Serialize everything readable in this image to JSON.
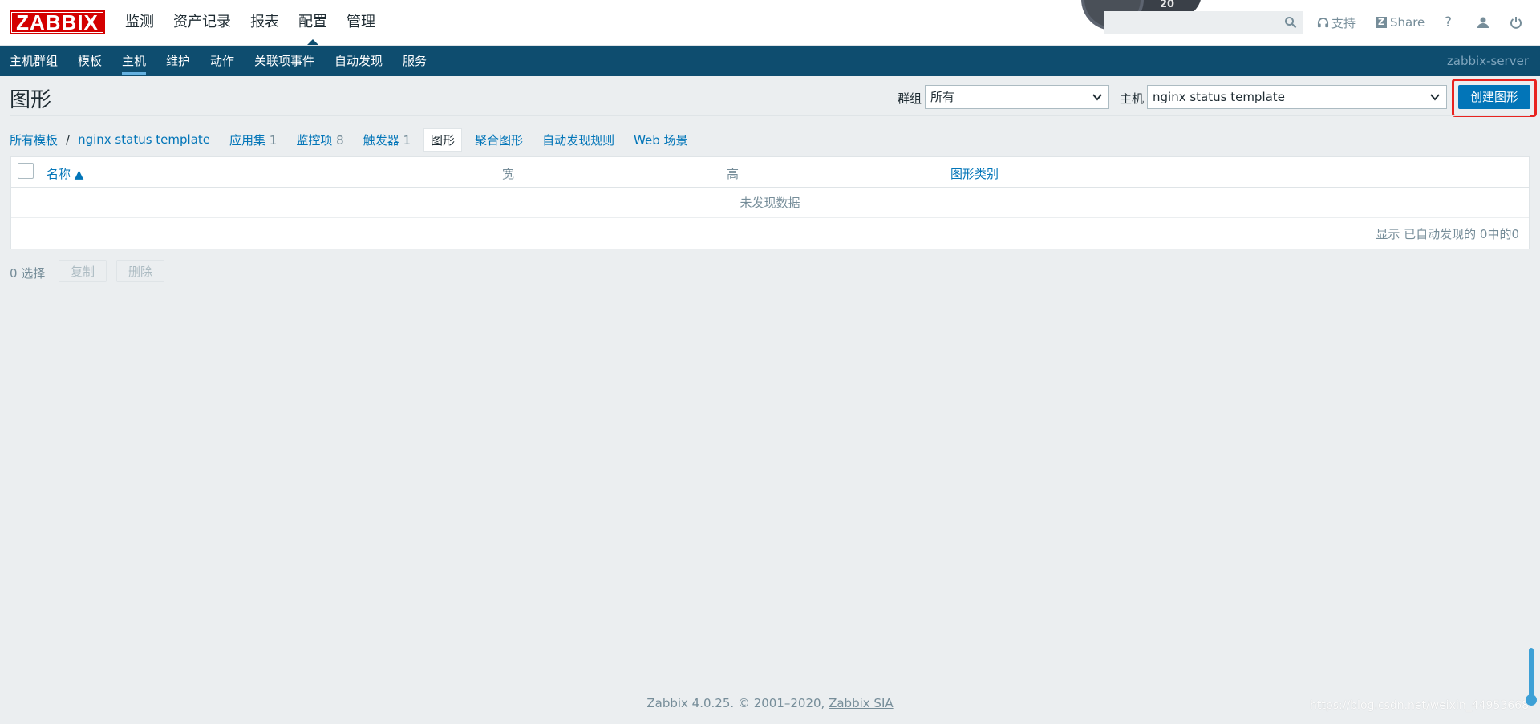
{
  "app": {
    "logo": "ZABBIX",
    "server_name": "zabbix-server"
  },
  "main_nav": [
    "监测",
    "资产记录",
    "报表",
    "配置",
    "管理"
  ],
  "main_nav_active": "配置",
  "top_right": {
    "support": "支持",
    "share": "Share",
    "help": "?",
    "gauge_value": "20"
  },
  "sub_nav": [
    "主机群组",
    "模板",
    "主机",
    "维护",
    "动作",
    "关联项事件",
    "自动发现",
    "服务"
  ],
  "sub_nav_active": "主机",
  "page": {
    "title": "图形",
    "filter_group_label": "群组",
    "filter_group_value": "所有",
    "filter_host_label": "主机",
    "filter_host_value": "nginx status template",
    "create_button": "创建图形"
  },
  "tabs": {
    "all_templates": "所有模板",
    "separator": "/",
    "template": "nginx status template",
    "applications": "应用集",
    "applications_count": "1",
    "items": "监控项",
    "items_count": "8",
    "triggers": "触发器",
    "triggers_count": "1",
    "graphs": "图形",
    "aggregate_graphs": "聚合图形",
    "discovery_rules": "自动发现规则",
    "web": "Web 场景"
  },
  "table": {
    "columns": [
      "名称 ▲",
      "宽",
      "高",
      "图形类别"
    ],
    "no_data": "未发现数据",
    "footer": "显示 已自动发现的 0中的0"
  },
  "actions": {
    "selected": "0 选择",
    "copy": "复制",
    "delete": "删除"
  },
  "footer": {
    "text": "Zabbix 4.0.25. © 2001–2020, ",
    "company": "Zabbix SIA"
  },
  "watermark": "https://blog.csdn.net/weixin_44953668",
  "colors": {
    "accent": "#0275b8",
    "subnav_bg": "#0e4d6f",
    "logo_red": "#d40000",
    "highlight": "#e8231f"
  }
}
